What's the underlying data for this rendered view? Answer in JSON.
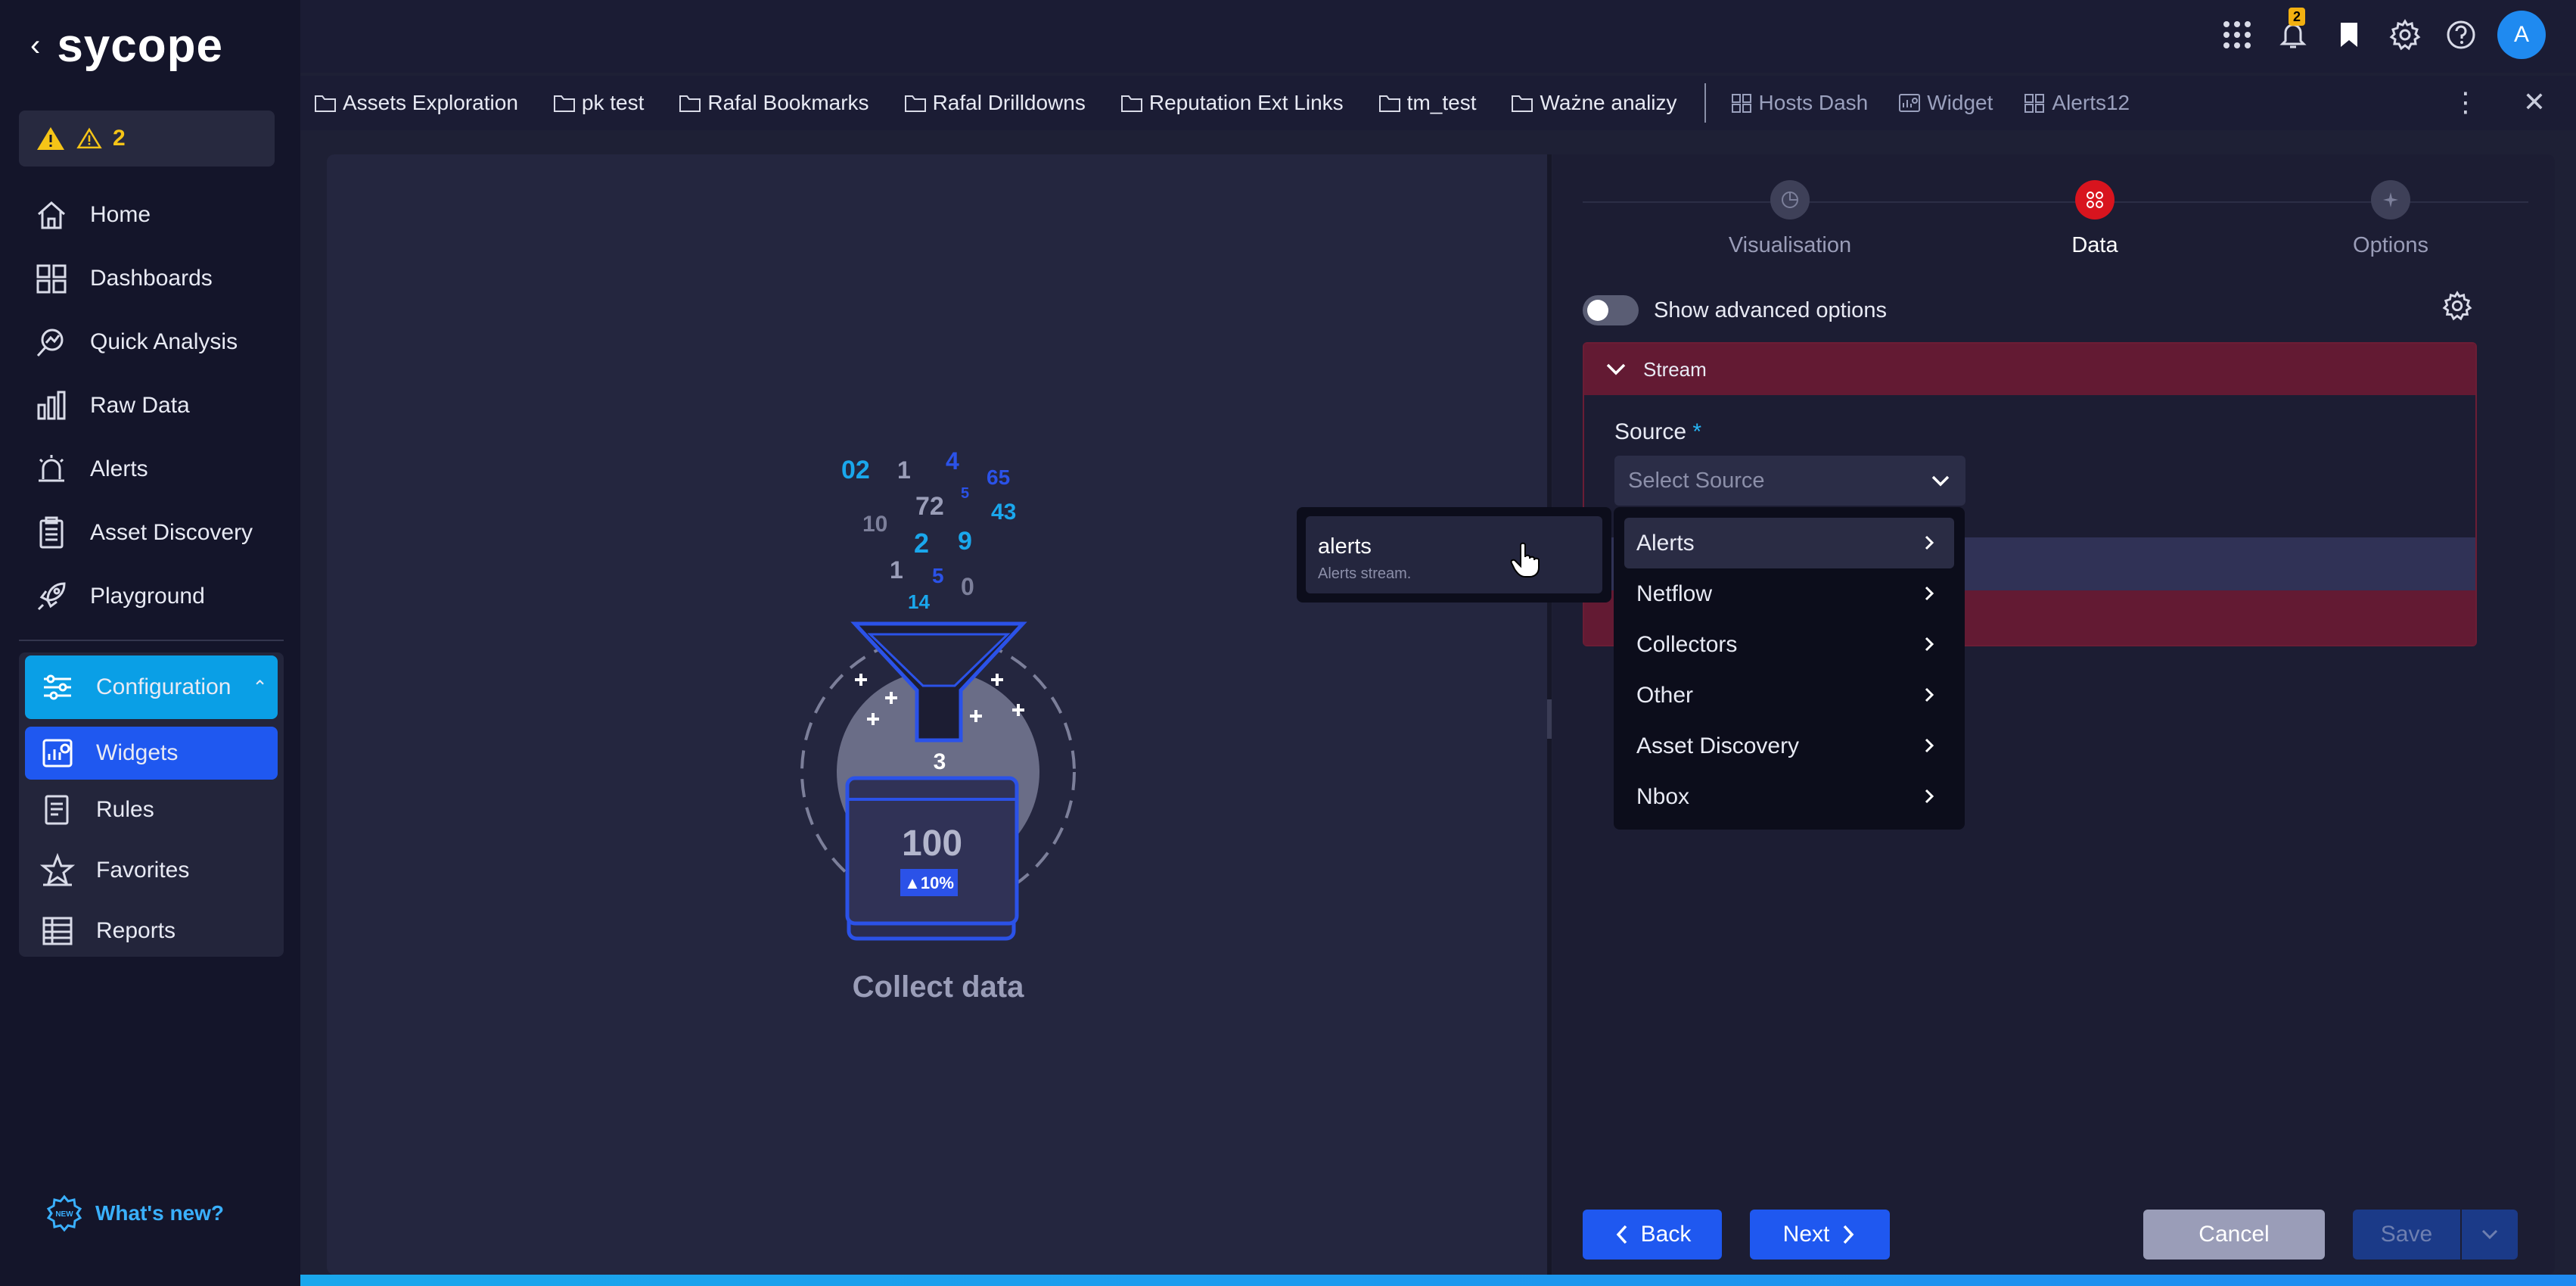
{
  "app": {
    "logo_text": "sycope",
    "alerts_count": "2",
    "notifications_count": "2",
    "avatar_letter": "A",
    "whats_new": "What's new?"
  },
  "sidebar": {
    "items": [
      {
        "label": "Home"
      },
      {
        "label": "Dashboards"
      },
      {
        "label": "Quick Analysis"
      },
      {
        "label": "Raw Data"
      },
      {
        "label": "Alerts"
      },
      {
        "label": "Asset Discovery"
      },
      {
        "label": "Playground"
      }
    ],
    "config_group": {
      "label": "Configuration",
      "items": [
        {
          "label": "Widgets"
        },
        {
          "label": "Rules"
        },
        {
          "label": "Favorites"
        },
        {
          "label": "Reports"
        }
      ]
    }
  },
  "bookmarks": {
    "folders": [
      "Assets Exploration",
      "pk test",
      "Rafal Bookmarks",
      "Rafal Drilldowns",
      "Reputation Ext Links",
      "tm_test",
      "Ważne analizy"
    ],
    "dashboards": [
      "Hosts Dash",
      "Widget",
      "Alerts12"
    ]
  },
  "illustration": {
    "label": "Collect data",
    "numbers": [
      "02",
      "1",
      "4",
      "65",
      "10",
      "72",
      "5",
      "43",
      "2",
      "9",
      "1",
      "5",
      "0",
      "14",
      "3"
    ],
    "card_value": "100",
    "card_delta": "▲10%"
  },
  "wizard": {
    "steps": [
      {
        "label": "Visualisation",
        "active": false
      },
      {
        "label": "Data",
        "active": true
      },
      {
        "label": "Options",
        "active": false
      }
    ],
    "advanced_toggle_label": "Show advanced options",
    "stream_title": "Stream",
    "source_label": "Source",
    "source_required": "*",
    "source_placeholder": "Select Source",
    "source_options": [
      "Alerts",
      "Netflow",
      "Collectors",
      "Other",
      "Asset Discovery",
      "Nbox"
    ],
    "submenu": {
      "title": "alerts",
      "description": "Alerts stream."
    },
    "buttons": {
      "back": "Back",
      "next": "Next",
      "cancel": "Cancel",
      "save": "Save"
    }
  },
  "colors": {
    "accent": "#1f58f0",
    "config_active": "#0a9fe6",
    "danger": "#d8141e",
    "stream_header": "#631a33",
    "warning": "#f5c417"
  }
}
